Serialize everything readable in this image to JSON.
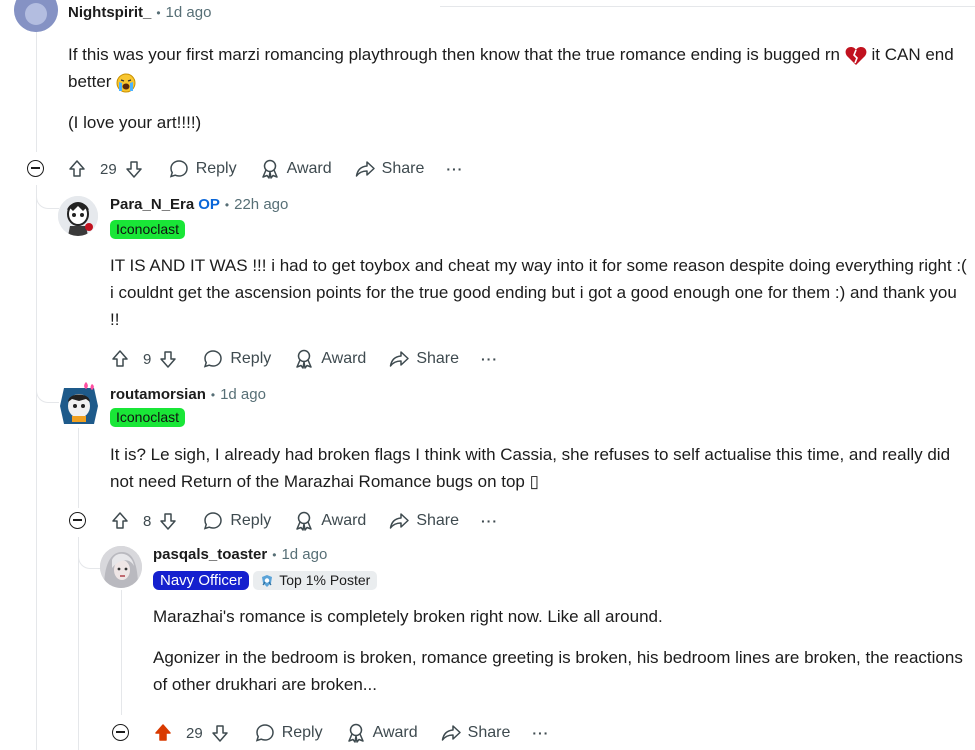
{
  "comments": [
    {
      "username": "Nightspirit_",
      "time": "1d ago",
      "body": [
        "If this was your first marzi romancing playthrough then know that the true romance ending is bugged rn",
        "it CAN end better",
        "(I love your art!!!!)"
      ],
      "votes": "29",
      "actions": {
        "reply": "Reply",
        "award": "Award",
        "share": "Share",
        "more": "···"
      }
    },
    {
      "username": "Para_N_Era",
      "op_badge": "OP",
      "time": "22h ago",
      "flair": "Iconoclast",
      "body": "IT IS AND IT WAS !!! i had to get toybox and cheat my way into it for some reason despite doing everything right :( i couldnt get the ascension points for the true good ending but i got a good enough one for them :) and thank you !!",
      "votes": "9",
      "actions": {
        "reply": "Reply",
        "award": "Award",
        "share": "Share",
        "more": "···"
      }
    },
    {
      "username": "routamorsian",
      "time": "1d ago",
      "flair": "Iconoclast",
      "body": "It is? Le sigh, I already had broken flags I think with Cassia, she refuses to self actualise this time, and really did not need Return of the Marazhai Romance bugs on top ▯",
      "votes": "8",
      "actions": {
        "reply": "Reply",
        "award": "Award",
        "share": "Share",
        "more": "···"
      }
    },
    {
      "username": "pasqals_toaster",
      "time": "1d ago",
      "flair": "Navy Officer",
      "badge": "Top 1% Poster",
      "body": [
        "Marazhai's romance is completely broken right now. Like all around.",
        "Agonizer in the bedroom is broken, romance greeting is broken, his bedroom lines are broken, the reactions of other drukhari are broken..."
      ],
      "votes": "29",
      "actions": {
        "reply": "Reply",
        "award": "Award",
        "share": "Share",
        "more": "···"
      }
    }
  ],
  "colors": {
    "upvote_active": "#d93a00",
    "flair_green": "#19e637",
    "flair_navy": "#1520ce",
    "op_blue": "#0a66d8"
  },
  "icons": [
    "upvote-icon",
    "downvote-icon",
    "reply-icon",
    "award-icon",
    "share-icon",
    "collapse-icon",
    "broken-heart-emoji",
    "crying-emoji",
    "shield-badge-icon"
  ]
}
